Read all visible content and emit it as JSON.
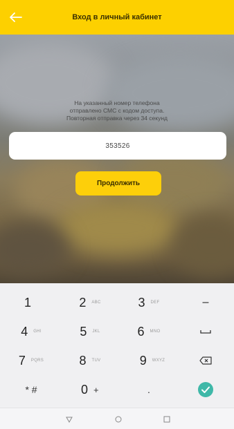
{
  "header": {
    "title": "Вход в личный кабинет",
    "back_icon": "arrow-left-icon",
    "color": "#fdd000"
  },
  "message": {
    "line1": "На указанный номер телефона",
    "line2": "отправлено СМС с кодом доступа.",
    "line3": "Повторная отправка через 34 секунд"
  },
  "code_input": {
    "value": "353526"
  },
  "continue_button": {
    "label": "Продолжить",
    "color": "#fdcf0a"
  },
  "keyboard": {
    "keys": [
      {
        "digit": "1",
        "letters": ""
      },
      {
        "digit": "2",
        "letters": "ABC"
      },
      {
        "digit": "3",
        "letters": "DEF"
      },
      {
        "digit": "4",
        "letters": "GHI"
      },
      {
        "digit": "5",
        "letters": "JKL"
      },
      {
        "digit": "6",
        "letters": "MNO"
      },
      {
        "digit": "7",
        "letters": "PQRS"
      },
      {
        "digit": "8",
        "letters": "TUV"
      },
      {
        "digit": "9",
        "letters": "WXYZ"
      },
      {
        "digit": "0",
        "letters": "+"
      }
    ],
    "symbols": {
      "minus": "–",
      "star_hash": "* #",
      "dot": "."
    },
    "action_icons": [
      "space-icon",
      "backspace-icon",
      "check-icon"
    ],
    "check_color": "#3fb8a8"
  },
  "navbar": {
    "icons": [
      "back-triangle-icon",
      "home-circle-icon",
      "recents-square-icon"
    ]
  }
}
